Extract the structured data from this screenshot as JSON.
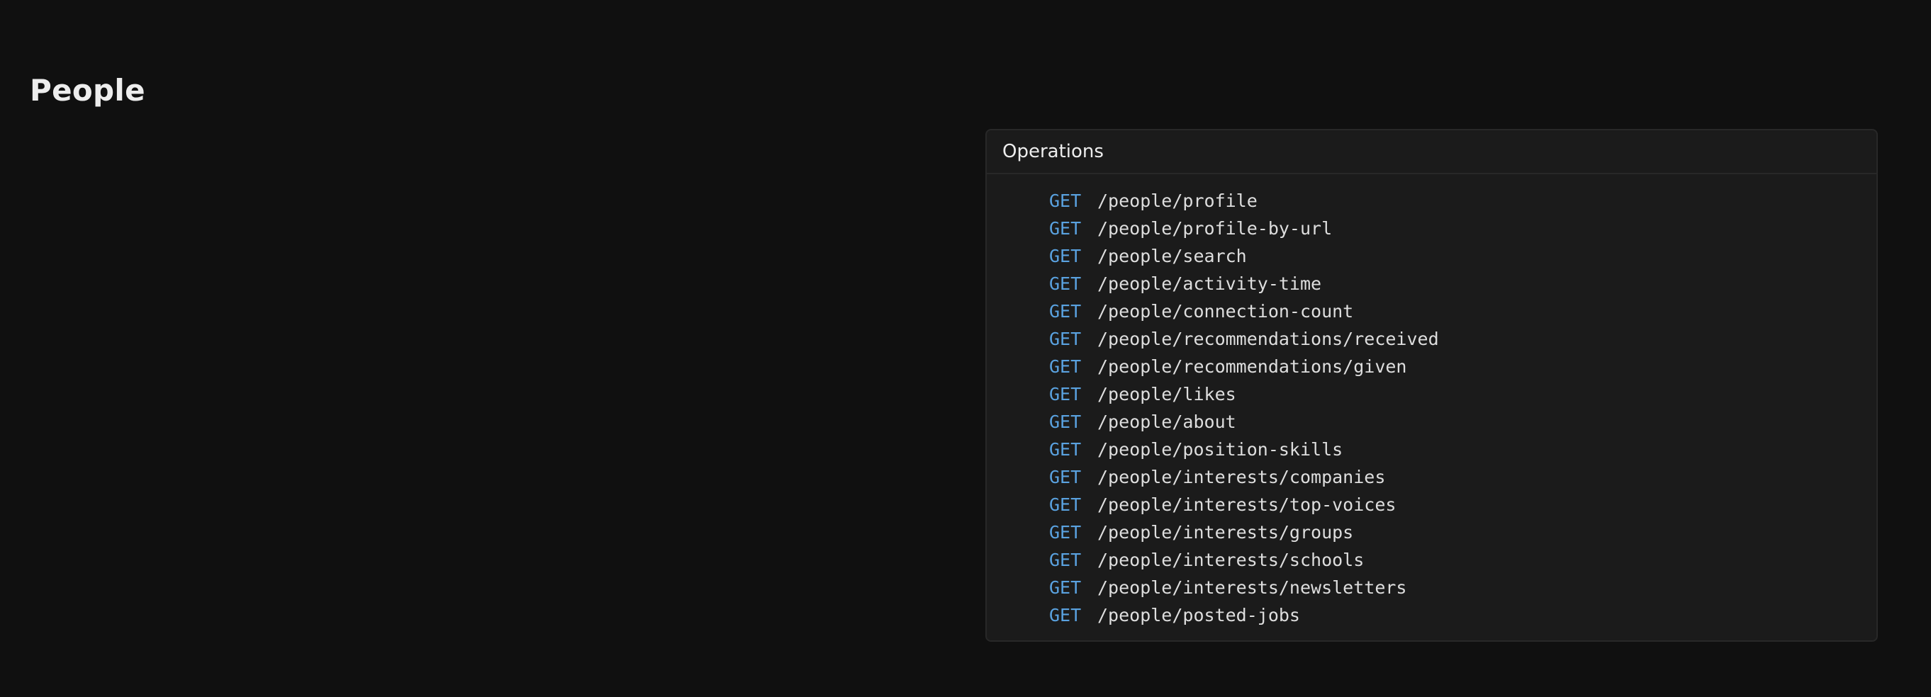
{
  "page": {
    "title": "People"
  },
  "operations": {
    "header": "Operations",
    "method_color": "#5aa2e0",
    "items": [
      {
        "method": "GET",
        "path": "/people/profile"
      },
      {
        "method": "GET",
        "path": "/people/profile-by-url"
      },
      {
        "method": "GET",
        "path": "/people/search"
      },
      {
        "method": "GET",
        "path": "/people/activity-time"
      },
      {
        "method": "GET",
        "path": "/people/connection-count"
      },
      {
        "method": "GET",
        "path": "/people/recommendations/received"
      },
      {
        "method": "GET",
        "path": "/people/recommendations/given"
      },
      {
        "method": "GET",
        "path": "/people/likes"
      },
      {
        "method": "GET",
        "path": "/people/about"
      },
      {
        "method": "GET",
        "path": "/people/position-skills"
      },
      {
        "method": "GET",
        "path": "/people/interests/companies"
      },
      {
        "method": "GET",
        "path": "/people/interests/top-voices"
      },
      {
        "method": "GET",
        "path": "/people/interests/groups"
      },
      {
        "method": "GET",
        "path": "/people/interests/schools"
      },
      {
        "method": "GET",
        "path": "/people/interests/newsletters"
      },
      {
        "method": "GET",
        "path": "/people/posted-jobs"
      }
    ]
  }
}
